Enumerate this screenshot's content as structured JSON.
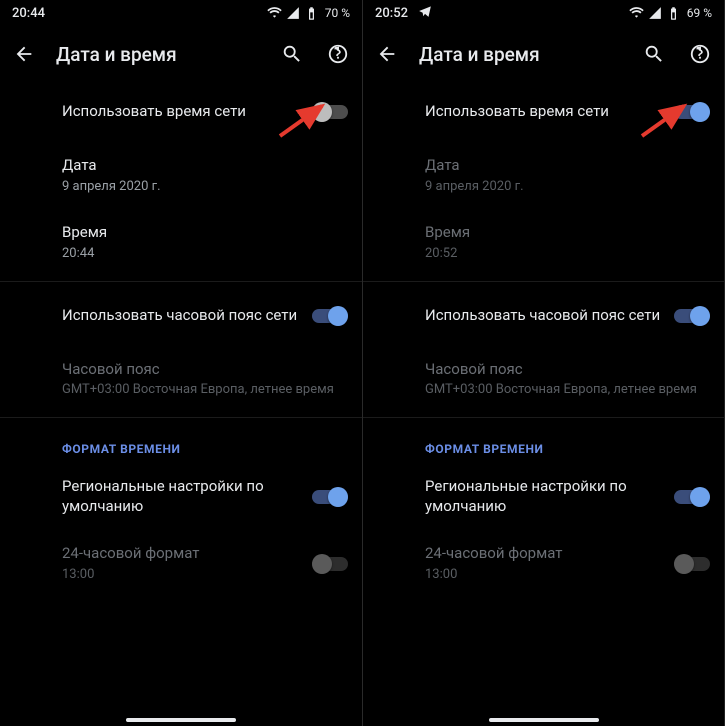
{
  "panes": [
    {
      "status": {
        "time": "20:44",
        "battery": "70 %",
        "telegram": false
      },
      "title": "Дата и время",
      "useNetTime": {
        "label": "Использовать время сети",
        "on": false
      },
      "date": {
        "label": "Дата",
        "value": "9 апреля 2020 г.",
        "disabled": false
      },
      "time": {
        "label": "Время",
        "value": "20:44",
        "disabled": false
      },
      "useNetTz": {
        "label": "Использовать часовой пояс сети",
        "on": true
      },
      "tz": {
        "label": "Часовой пояс",
        "value": "GMT+03:00 Восточная Европа, летнее время",
        "disabled": true
      },
      "sectionFormat": "ФОРМАТ ВРЕМЕНИ",
      "regional": {
        "label": "Региональные настройки по умолчанию",
        "on": true
      },
      "hour24": {
        "label": "24-часовой формат",
        "value": "13:00",
        "disabled": true,
        "on": false
      }
    },
    {
      "status": {
        "time": "20:52",
        "battery": "69 %",
        "telegram": true
      },
      "title": "Дата и время",
      "useNetTime": {
        "label": "Использовать время сети",
        "on": true
      },
      "date": {
        "label": "Дата",
        "value": "9 апреля 2020 г.",
        "disabled": true
      },
      "time": {
        "label": "Время",
        "value": "20:52",
        "disabled": true
      },
      "useNetTz": {
        "label": "Использовать часовой пояс сети",
        "on": true
      },
      "tz": {
        "label": "Часовой пояс",
        "value": "GMT+03:00 Восточная Европа, летнее время",
        "disabled": true
      },
      "sectionFormat": "ФОРМАТ ВРЕМЕНИ",
      "regional": {
        "label": "Региональные настройки по умолчанию",
        "on": true
      },
      "hour24": {
        "label": "24-часовой формат",
        "value": "13:00",
        "disabled": true,
        "on": false
      }
    }
  ]
}
